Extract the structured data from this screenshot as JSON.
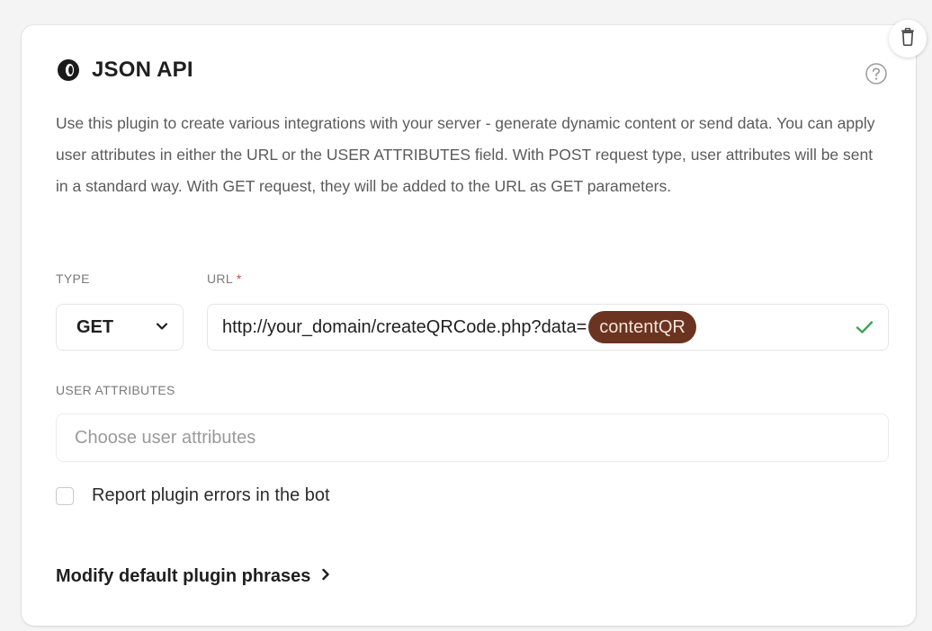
{
  "plugin": {
    "title": "JSON API",
    "description": "Use this plugin to create various integrations with your server - generate dynamic content or send data. You can apply user attributes in either the URL or the USER ATTRIBUTES field. With POST request type, user attributes will be sent in a standard way. With GET request, they will be added to the URL as GET parameters."
  },
  "icons": {
    "logo": "json-api-logo-icon",
    "help": "question-circle-icon",
    "delete": "trash-icon",
    "select_arrow": "chevron-down-icon",
    "url_valid": "check-icon",
    "link_arrow": "chevron-right-icon"
  },
  "type_field": {
    "label": "TYPE",
    "selected": "GET"
  },
  "url_field": {
    "label": "URL",
    "required_mark": "*",
    "value": "http://your_domain/createQRCode.php?data=",
    "attribute_chip": "contentQR"
  },
  "user_attributes_field": {
    "label": "USER ATTRIBUTES",
    "placeholder": "Choose user attributes"
  },
  "report_errors": {
    "label": "Report plugin errors in the bot",
    "checked": false
  },
  "modify_phrases_link": "Modify default plugin phrases",
  "colors": {
    "attribute_chip_bg": "#6a3421",
    "valid_check": "#3aa655",
    "required_asterisk": "#d8473b"
  }
}
